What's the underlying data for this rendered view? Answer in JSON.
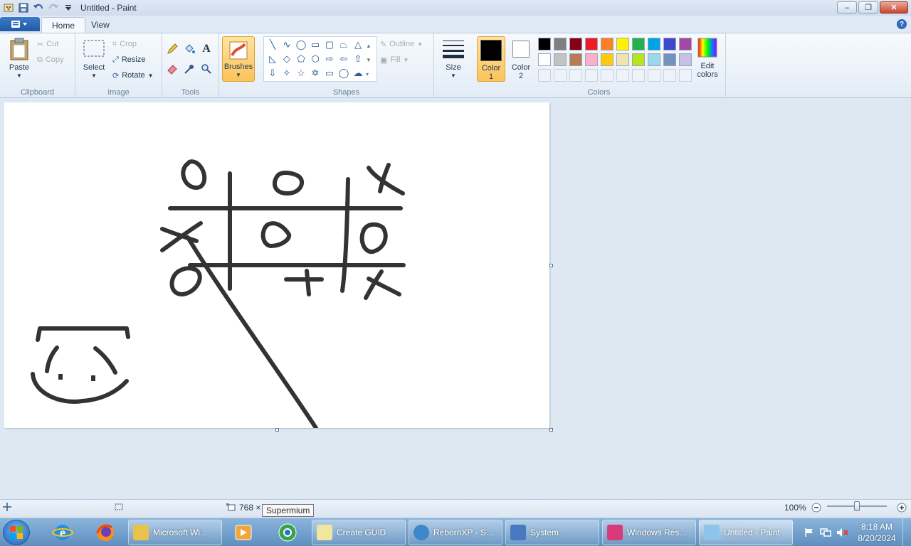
{
  "window": {
    "title": "Untitled - Paint",
    "controls": {
      "minimize": "–",
      "maximize": "❐",
      "close": "✕"
    }
  },
  "tabs": {
    "home": "Home",
    "view": "View"
  },
  "ribbon": {
    "clipboard": {
      "label": "Clipboard",
      "paste": "Paste",
      "cut": "Cut",
      "copy": "Copy"
    },
    "image": {
      "label": "Image",
      "select": "Select",
      "crop": "Crop",
      "resize": "Resize",
      "rotate": "Rotate"
    },
    "tools": {
      "label": "Tools"
    },
    "brushes": {
      "label": "Brushes"
    },
    "shapes": {
      "label": "Shapes",
      "outline": "Outline",
      "fill": "Fill"
    },
    "size": {
      "label": "Size"
    },
    "colors": {
      "label": "Colors",
      "color1_line1": "Color",
      "color1_line2": "1",
      "color2_line1": "Color",
      "color2_line2": "2",
      "edit_line1": "Edit",
      "edit_line2": "colors",
      "color1_value": "#000000",
      "color2_value": "#ffffff",
      "palette_row1": [
        "#000000",
        "#7f7f7f",
        "#880015",
        "#ed1c24",
        "#ff7f27",
        "#fff200",
        "#22b14c",
        "#00a2e8",
        "#3f48cc",
        "#a349a4"
      ],
      "palette_row2": [
        "#ffffff",
        "#c3c3c3",
        "#b97a57",
        "#ffaec9",
        "#ffc90e",
        "#efe4b0",
        "#b5e61d",
        "#99d9ea",
        "#7092be",
        "#c8bfe7"
      ]
    }
  },
  "status": {
    "dimensions": "768 ×",
    "tooltip": "Supermium",
    "zoom": "100%"
  },
  "taskbar": {
    "tasks": [
      {
        "label": "Microsoft Wi...",
        "color": "#e8c24a"
      },
      {
        "label": "Create GUID",
        "color": "#f0e6a0"
      },
      {
        "label": "RebornXP - S...",
        "color": "#3d87c9"
      },
      {
        "label": "System",
        "color": "#4a78c0"
      },
      {
        "label": "Windows Res...",
        "color": "#d83a7a"
      },
      {
        "label": "Untitled - Paint",
        "color": "#8ec3ea"
      }
    ],
    "time": "8:18 AM",
    "date": "8/20/2024"
  }
}
